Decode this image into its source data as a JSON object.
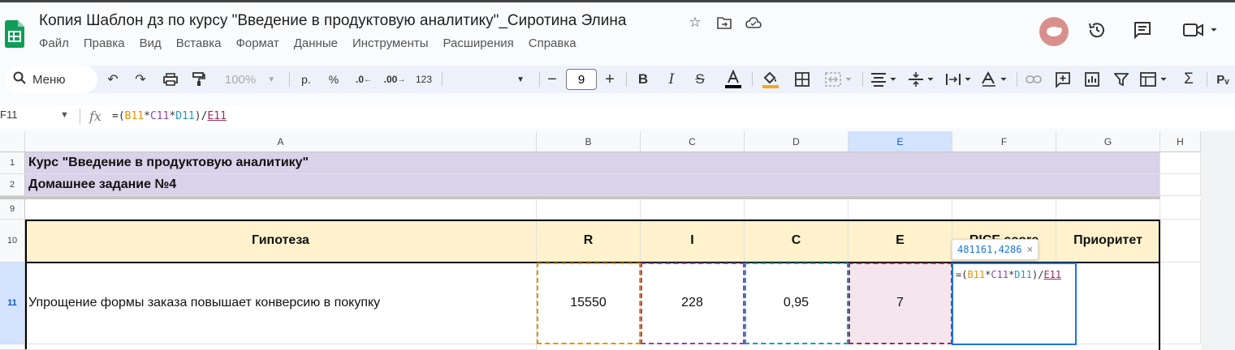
{
  "document": {
    "title": "Копия Шаблон дз по курсу \"Введение в продуктовую аналитику\"_Сиротина Элина"
  },
  "menu": [
    "Файл",
    "Правка",
    "Вид",
    "Вставка",
    "Формат",
    "Данные",
    "Инструменты",
    "Расширения",
    "Справка"
  ],
  "toolbar": {
    "search_label": "Меню",
    "zoom": "100%",
    "currency": "р.",
    "percent": "%",
    "dec_decrease": ".0",
    "dec_increase": ".00",
    "format_num": "123",
    "font_size": "9"
  },
  "formula_bar": {
    "cell_ref": "F11",
    "fx": "fx",
    "formula": {
      "open": "=(",
      "b": "B11",
      "star1": "*",
      "c": "C11",
      "star2": "*",
      "d": "D11",
      "close": ")/",
      "e": "E11"
    }
  },
  "columns": [
    "A",
    "B",
    "C",
    "D",
    "E",
    "F",
    "G",
    "H"
  ],
  "rows": [
    "1",
    "2",
    "9",
    "10",
    "11"
  ],
  "sheet": {
    "r1": "Курс \"Введение в продуктовую аналитику\"",
    "r2": "Домашнее задание №4",
    "headers": {
      "a": "Гипотеза",
      "b": "R",
      "c": "I",
      "d": "C",
      "e": "E",
      "f": "RICE score",
      "g": "Приоритет"
    },
    "row11": {
      "a": "Упрощение формы заказа повышает конверсию в покупку",
      "b": "15550",
      "c": "228",
      "d": "0,95",
      "e": "7"
    },
    "tooltip": "481161,4286",
    "tooltip_close": "×"
  },
  "colors": {
    "purple_band": "#d9d2e9",
    "header_band": "#fff2cc",
    "selection": "#1a73e8",
    "ref_b": "#e69100",
    "ref_c": "#8e44ad",
    "ref_d": "#1e9bb5",
    "ref_e": "#9b2b5b"
  }
}
